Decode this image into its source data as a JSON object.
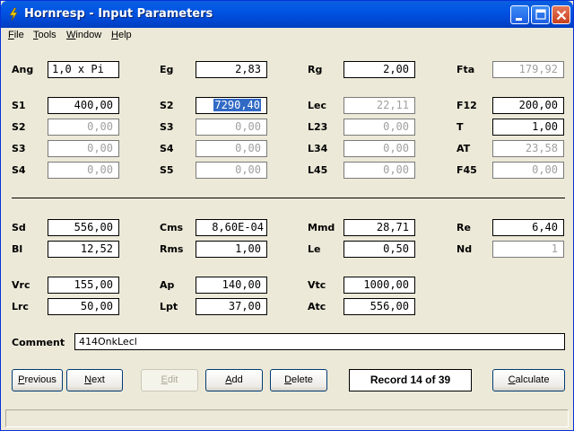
{
  "window": {
    "title": "Hornresp - Input Parameters"
  },
  "menu": [
    {
      "first": "F",
      "rest": "ile"
    },
    {
      "first": "T",
      "rest": "ools"
    },
    {
      "first": "W",
      "rest": "indow"
    },
    {
      "first": "H",
      "rest": "elp"
    }
  ],
  "params": {
    "Ang": {
      "label": "Ang",
      "value": "1,0 x Pi"
    },
    "Eg": {
      "label": "Eg",
      "value": "2,83"
    },
    "Rg": {
      "label": "Rg",
      "value": "2,00"
    },
    "Fta": {
      "label": "Fta",
      "value": "179,92"
    },
    "S1": {
      "label": "S1",
      "value": "400,00"
    },
    "S2a": {
      "label": "S2",
      "value": "7290,40"
    },
    "Lec": {
      "label": "Lec",
      "value": "22,11"
    },
    "F12": {
      "label": "F12",
      "value": "200,00"
    },
    "S2b": {
      "label": "S2",
      "value": "0,00"
    },
    "S3a": {
      "label": "S3",
      "value": "0,00"
    },
    "L23": {
      "label": "L23",
      "value": "0,00"
    },
    "T": {
      "label": "T",
      "value": "1,00"
    },
    "S3b": {
      "label": "S3",
      "value": "0,00"
    },
    "S4a": {
      "label": "S4",
      "value": "0,00"
    },
    "L34": {
      "label": "L34",
      "value": "0,00"
    },
    "AT": {
      "label": "AT",
      "value": "23,58"
    },
    "S4b": {
      "label": "S4",
      "value": "0,00"
    },
    "S5": {
      "label": "S5",
      "value": "0,00"
    },
    "L45": {
      "label": "L45",
      "value": "0,00"
    },
    "F45": {
      "label": "F45",
      "value": "0,00"
    },
    "Sd": {
      "label": "Sd",
      "value": "556,00"
    },
    "Cms": {
      "label": "Cms",
      "value": "8,60E-04"
    },
    "Mmd": {
      "label": "Mmd",
      "value": "28,71"
    },
    "Re": {
      "label": "Re",
      "value": "6,40"
    },
    "Bl": {
      "label": "Bl",
      "value": "12,52"
    },
    "Rms": {
      "label": "Rms",
      "value": "1,00"
    },
    "Le": {
      "label": "Le",
      "value": "0,50"
    },
    "Nd": {
      "label": "Nd",
      "value": "1"
    },
    "Vrc": {
      "label": "Vrc",
      "value": "155,00"
    },
    "Ap": {
      "label": "Ap",
      "value": "140,00"
    },
    "Vtc": {
      "label": "Vtc",
      "value": "1000,00"
    },
    "Lrc": {
      "label": "Lrc",
      "value": "50,00"
    },
    "Lpt": {
      "label": "Lpt",
      "value": "37,00"
    },
    "Atc": {
      "label": "Atc",
      "value": "556,00"
    }
  },
  "comment": {
    "label": "Comment",
    "value": "414OnkLecl"
  },
  "buttons": {
    "previous": {
      "first": "P",
      "rest": "revious"
    },
    "next": {
      "first": "N",
      "rest": "ext"
    },
    "edit": {
      "first": "E",
      "rest": "dit"
    },
    "add": {
      "first": "A",
      "rest": "dd"
    },
    "delete": {
      "first": "D",
      "rest": "elete"
    },
    "calculate": {
      "first": "C",
      "rest": "alculate"
    }
  },
  "record": "Record 14 of 39",
  "colors": {
    "titlebar": "#0054e3",
    "selection": "#316ac5",
    "face": "#ece9d8"
  }
}
